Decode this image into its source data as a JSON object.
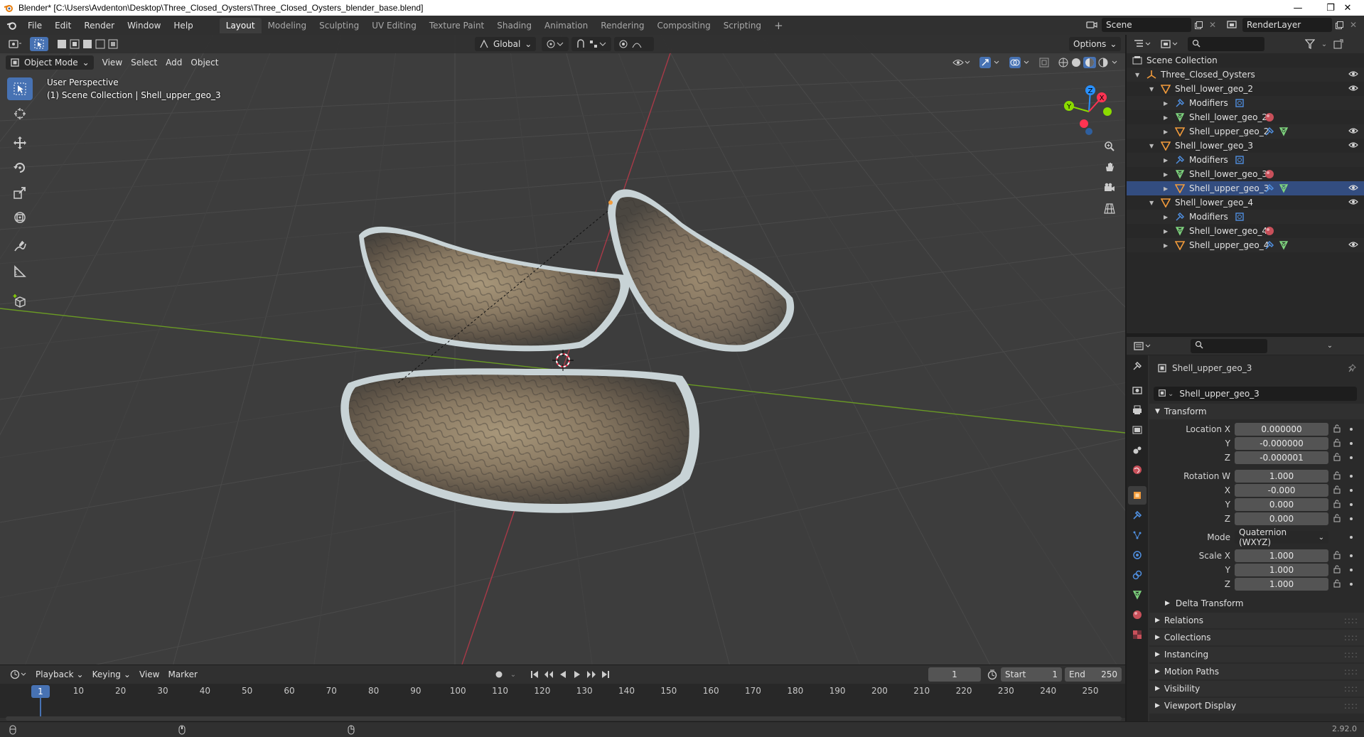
{
  "window": {
    "title": "Blender* [C:\\Users\\Avdenton\\Desktop\\Three_Closed_Oysters\\Three_Closed_Oysters_blender_base.blend]"
  },
  "menu": [
    "File",
    "Edit",
    "Render",
    "Window",
    "Help"
  ],
  "workspaces": [
    {
      "label": "Layout",
      "active": true
    },
    {
      "label": "Modeling"
    },
    {
      "label": "Sculpting"
    },
    {
      "label": "UV Editing"
    },
    {
      "label": "Texture Paint"
    },
    {
      "label": "Shading"
    },
    {
      "label": "Animation"
    },
    {
      "label": "Rendering"
    },
    {
      "label": "Compositing"
    },
    {
      "label": "Scripting"
    }
  ],
  "scene": {
    "name": "Scene",
    "view_layer": "RenderLayer"
  },
  "viewport": {
    "transform_orientation": "Global",
    "options_label": "Options",
    "mode": "Object Mode",
    "menus": [
      "View",
      "Select",
      "Add",
      "Object"
    ],
    "perspective_label": "User Perspective",
    "context_label": "(1) Scene Collection | Shell_upper_geo_3",
    "gizmo_axes": [
      "X",
      "Y",
      "Z"
    ]
  },
  "outliner": {
    "rows": [
      {
        "label": "Scene Collection",
        "indent": 0,
        "type": "collection-root"
      },
      {
        "label": "Three_Closed_Oysters",
        "indent": 1,
        "type": "empty",
        "expanded": true,
        "eye": true
      },
      {
        "label": "Shell_lower_geo_2",
        "indent": 2,
        "type": "object",
        "expanded": true,
        "eye": true
      },
      {
        "label": "Modifiers",
        "indent": 3,
        "type": "modifiers"
      },
      {
        "label": "Shell_lower_geo_2",
        "indent": 3,
        "type": "mesh"
      },
      {
        "label": "Shell_upper_geo_2",
        "indent": 3,
        "type": "object-child",
        "eye": true
      },
      {
        "label": "Shell_lower_geo_3",
        "indent": 2,
        "type": "object",
        "expanded": true,
        "eye": true
      },
      {
        "label": "Modifiers",
        "indent": 3,
        "type": "modifiers"
      },
      {
        "label": "Shell_lower_geo_3",
        "indent": 3,
        "type": "mesh"
      },
      {
        "label": "Shell_upper_geo_3",
        "indent": 3,
        "type": "object-child",
        "eye": true,
        "selected": true
      },
      {
        "label": "Shell_lower_geo_4",
        "indent": 2,
        "type": "object",
        "expanded": true,
        "eye": true
      },
      {
        "label": "Modifiers",
        "indent": 3,
        "type": "modifiers"
      },
      {
        "label": "Shell_lower_geo_4",
        "indent": 3,
        "type": "mesh"
      },
      {
        "label": "Shell_upper_geo_4",
        "indent": 3,
        "type": "object-child",
        "eye": true
      }
    ]
  },
  "properties": {
    "object_name": "Shell_upper_geo_3",
    "datablock_name": "Shell_upper_geo_3",
    "transform_title": "Transform",
    "location": {
      "label": "Location X",
      "x": "0.000000",
      "y": "-0.000000",
      "z": "-0.000001"
    },
    "rotation": {
      "label": "Rotation W",
      "w": "1.000",
      "x": "-0.000",
      "y": "0.000",
      "z": "0.000"
    },
    "mode_label": "Mode",
    "mode_value": "Quaternion (WXYZ)",
    "scale": {
      "label": "Scale X",
      "x": "1.000",
      "y": "1.000",
      "z": "1.000"
    },
    "axis_y": "Y",
    "axis_z": "Z",
    "axis_x": "X",
    "delta_transform": "Delta Transform",
    "sections": [
      "Relations",
      "Collections",
      "Instancing",
      "Motion Paths",
      "Visibility",
      "Viewport Display"
    ]
  },
  "timeline": {
    "menus": [
      "Playback",
      "Keying",
      "View",
      "Marker"
    ],
    "current_frame": "1",
    "start_label": "Start",
    "start_value": "1",
    "end_label": "End",
    "end_value": "250",
    "ruler_ticks": [
      "10",
      "20",
      "30",
      "40",
      "50",
      "60",
      "70",
      "80",
      "90",
      "100",
      "110",
      "120",
      "130",
      "140",
      "150",
      "160",
      "170",
      "180",
      "190",
      "200",
      "210",
      "220",
      "230",
      "240",
      "250"
    ],
    "playhead_label": "1"
  },
  "statusbar": {
    "version": "2.92.0"
  },
  "colors": {
    "accent": "#4772b3",
    "selection": "#334d80",
    "x_axis": "#ff3352",
    "y_axis": "#8bdc00",
    "z_axis": "#2890ff",
    "object_orange": "#f29b3b",
    "mesh_green": "#7fd67f"
  }
}
